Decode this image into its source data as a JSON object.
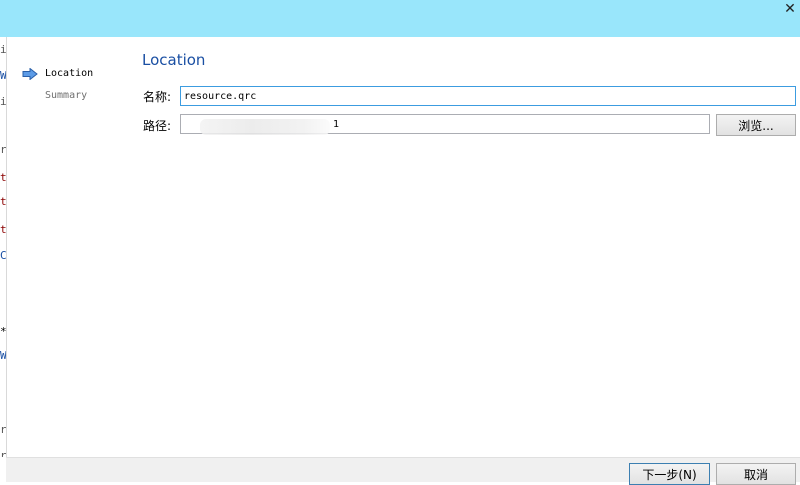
{
  "window": {
    "close_glyph": "✕",
    "titlebar_color": "#99e6fb"
  },
  "background_strip": {
    "fragments": [
      "i",
      "W",
      "i",
      "r",
      "t",
      "t",
      "t",
      "C",
      "*",
      "W",
      "r",
      "r"
    ]
  },
  "steps": [
    {
      "label": "Location",
      "active": true,
      "icon": "arrow-right-icon"
    },
    {
      "label": "Summary",
      "active": false
    }
  ],
  "page": {
    "title": "Location"
  },
  "form": {
    "name_label": "名称:",
    "name_value": "resource.qrc",
    "path_label": "路径:",
    "path_value": "1",
    "browse_label": "浏览..."
  },
  "footer": {
    "next_label": "下一步(N)",
    "cancel_label": "取消"
  },
  "colors": {
    "accent": "#1a4fa3",
    "focus_border": "#3c9ce0",
    "background_text": "#8b0000"
  }
}
